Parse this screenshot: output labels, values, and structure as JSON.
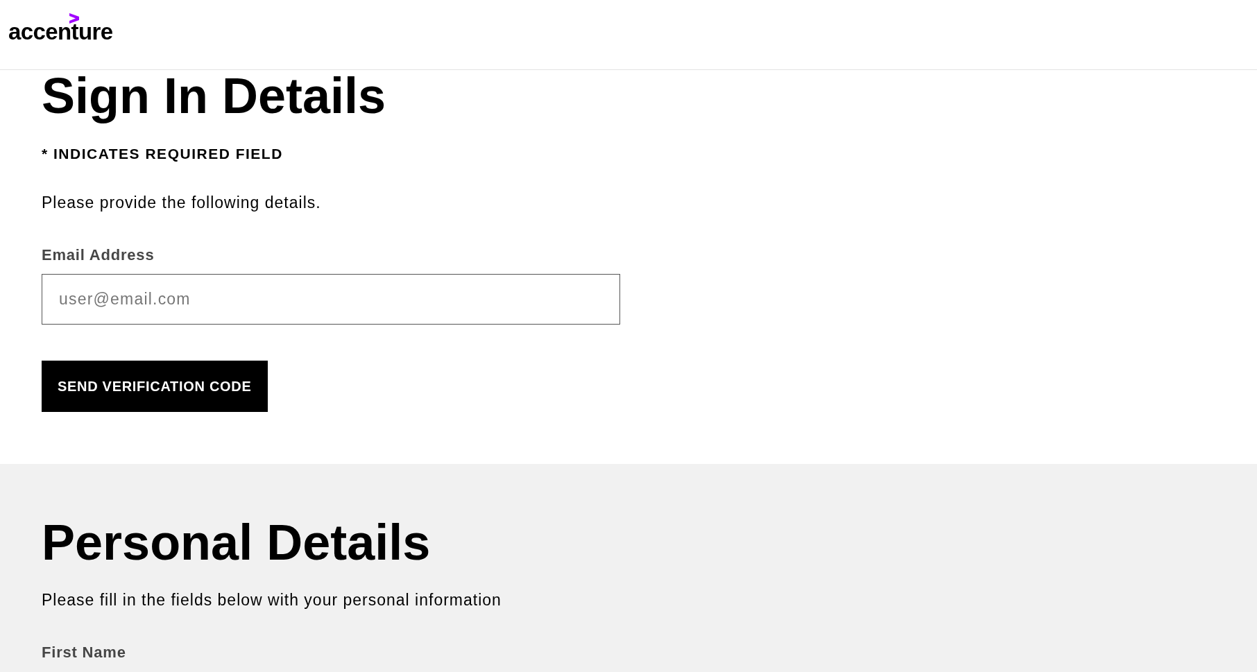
{
  "header": {
    "logo": "accenture"
  },
  "sign_in": {
    "title": "Sign In Details",
    "required_note": "* INDICATES REQUIRED FIELD",
    "intro": "Please provide the following details.",
    "fields": [
      {
        "label": "Email Address",
        "placeholder": "user@email.com"
      }
    ],
    "button": "SEND VERIFICATION CODE"
  },
  "personal": {
    "title": "Personal Details",
    "intro": "Please fill in the fields below with your personal information",
    "fields": [
      {
        "label": "First Name"
      }
    ]
  }
}
